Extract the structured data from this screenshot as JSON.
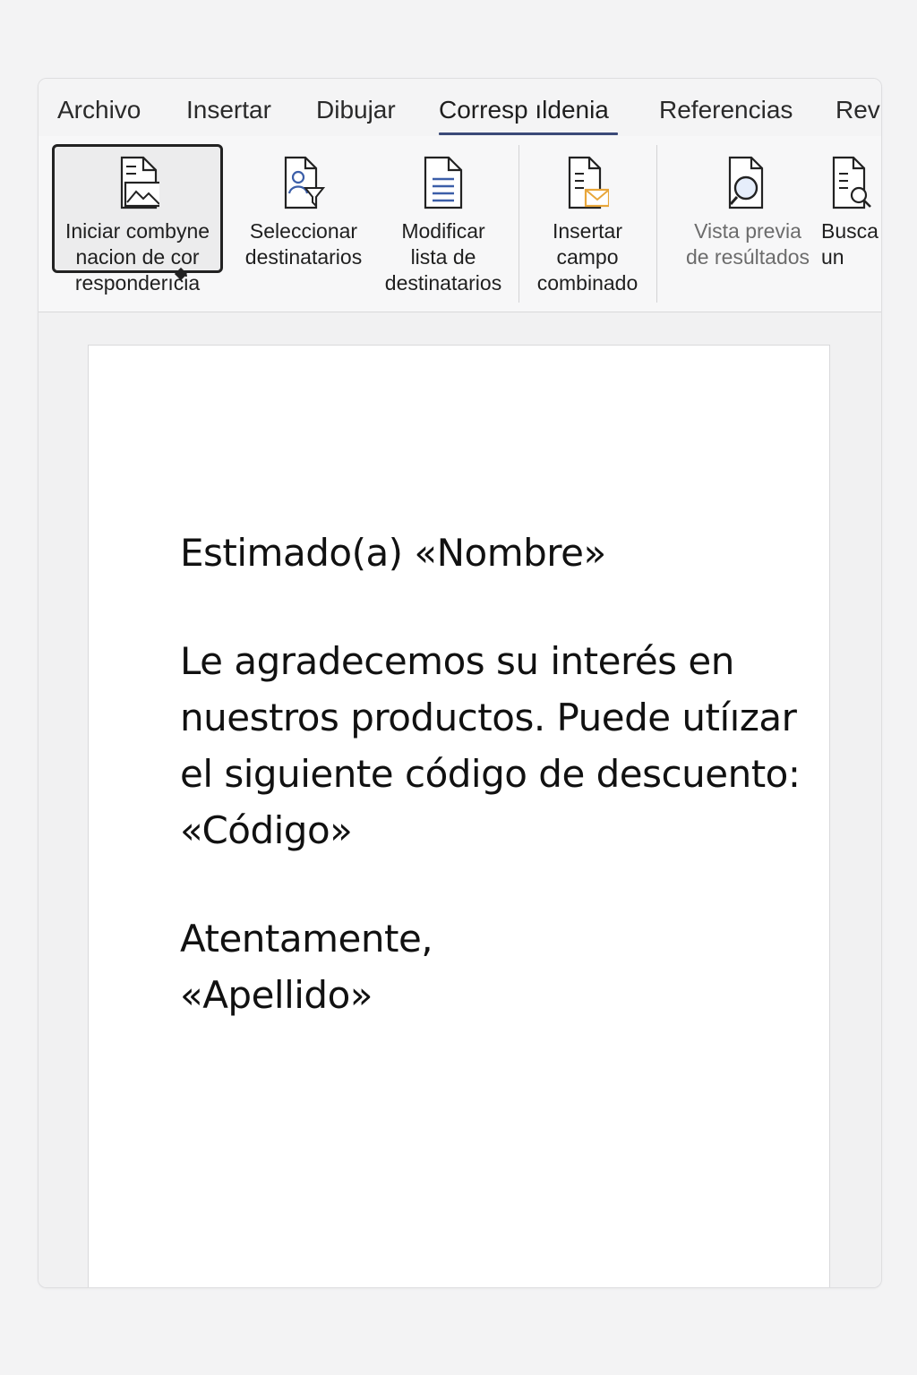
{
  "tabs": [
    {
      "label": "Archivo"
    },
    {
      "label": "Insertar"
    },
    {
      "label": "Dibujar"
    },
    {
      "label": "Corresp ıldenia",
      "active": true
    },
    {
      "label": "Referencias"
    },
    {
      "label": "Rev"
    }
  ],
  "ribbon": {
    "start_merge": {
      "label": "Iniciar combyne\nnacion de cor\nresponderıcia",
      "icon": "document-image-icon"
    },
    "select_recipients": {
      "label": "Seleccionar\ndestinatarios",
      "icon": "select-person-icon"
    },
    "edit_list": {
      "label": "Modificar\nlista de\ndestinatarios",
      "icon": "document-list-icon"
    },
    "insert_field": {
      "label": "Insertar\ncampo\ncombinado",
      "icon": "document-mail-icon"
    },
    "preview": {
      "label": "Vista previa\nde resúltados",
      "icon": "preview-magnifier-icon",
      "disabled": true
    },
    "find": {
      "label": "Busca\nun",
      "icon": "find-document-icon"
    }
  },
  "document": {
    "greeting": "Estimado(a)  «Nombre»",
    "body": "Le agradecemos su interés en nuestros productos. Puede utíızar el siguiente código de descuento: «Código»",
    "closing": "Atentamente,",
    "signature": "«Apellido»"
  },
  "colors": {
    "accent": "#3b4a78",
    "mail_icon": "#e8a63a",
    "icon_blue": "#3b5ea8"
  }
}
